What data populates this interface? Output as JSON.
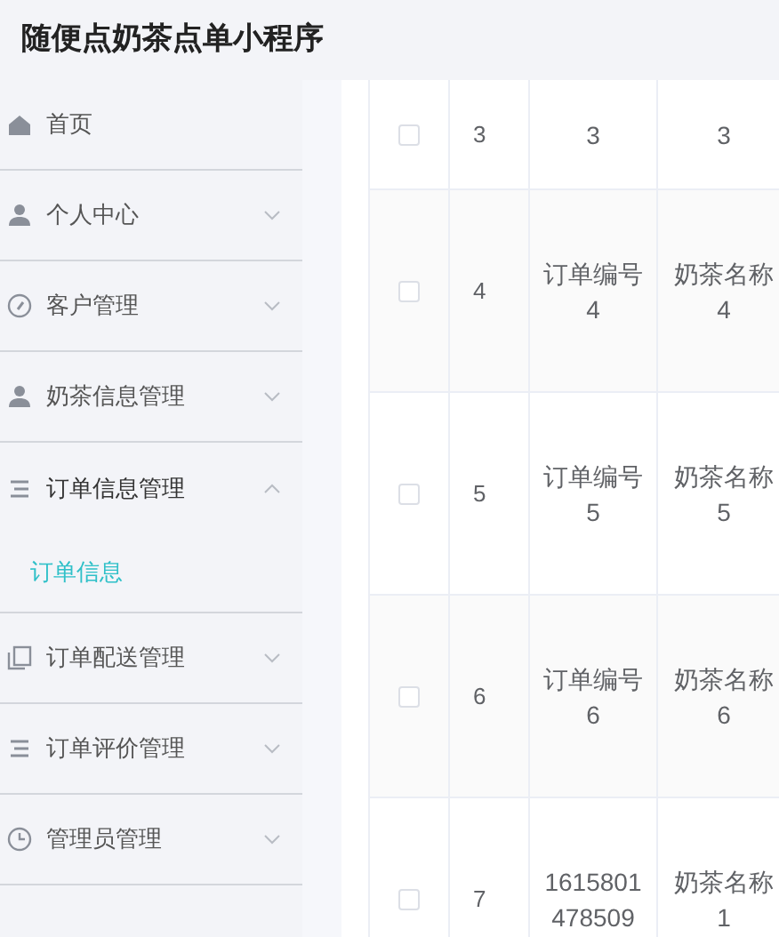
{
  "header": {
    "title": "随便点奶茶点单小程序"
  },
  "sidebar": {
    "items": [
      {
        "label": "首页"
      },
      {
        "label": "个人中心",
        "expanded": false
      },
      {
        "label": "客户管理",
        "expanded": false
      },
      {
        "label": "奶茶信息管理",
        "expanded": false
      },
      {
        "label": "订单信息管理",
        "expanded": true,
        "children": [
          {
            "label": "订单信息",
            "selected": true
          }
        ]
      },
      {
        "label": "订单配送管理",
        "expanded": false
      },
      {
        "label": "订单评价管理",
        "expanded": false
      },
      {
        "label": "管理员管理",
        "expanded": false
      }
    ]
  },
  "table": {
    "rows": [
      {
        "index": "3",
        "order_no": "3",
        "tea_name": "3",
        "checked": false
      },
      {
        "index": "4",
        "order_no": "订单编号4",
        "tea_name": "奶茶名称4",
        "checked": false
      },
      {
        "index": "5",
        "order_no": "订单编号5",
        "tea_name": "奶茶名称5",
        "checked": false
      },
      {
        "index": "6",
        "order_no": "订单编号6",
        "tea_name": "奶茶名称6",
        "checked": false
      },
      {
        "index": "7",
        "order_no": "1615801478509",
        "tea_name": "奶茶名称1",
        "checked": false
      }
    ]
  }
}
